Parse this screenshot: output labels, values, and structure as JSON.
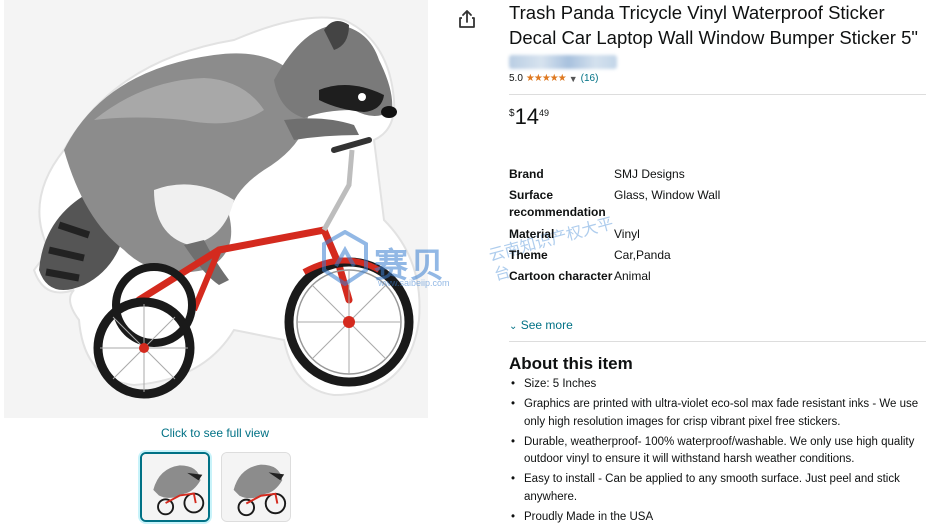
{
  "gallery": {
    "see_full_view": "Click to see full view",
    "thumbnails": [
      "raccoon-tricycle-sticker",
      "raccoon-tricycle-sticker"
    ]
  },
  "watermark": {
    "main": "赛贝",
    "side": "云南知识产权大平台",
    "url": "www.saibeiip.com"
  },
  "product": {
    "title": "Trash Panda Tricycle Vinyl Waterproof Sticker Decal Car Laptop Wall Window Bumper Sticker 5\"",
    "rating": "5.0",
    "stars": "★★★★★",
    "review_count": "(16)",
    "price_symbol": "$",
    "price_whole": "14",
    "price_fraction": "49",
    "specs": [
      {
        "key": "Brand",
        "value": "SMJ Designs"
      },
      {
        "key": "Surface recommendation",
        "value": "Glass, Window Wall"
      },
      {
        "key": "Material",
        "value": "Vinyl"
      },
      {
        "key": "Theme",
        "value": "Car,Panda"
      },
      {
        "key": "Cartoon character",
        "value": "Animal"
      }
    ],
    "see_more": "See more",
    "about_title": "About this item",
    "bullets": [
      "Size: 5 Inches",
      "Graphics are printed with ultra-violet eco-sol max fade resistant inks - We use only high resolution images for crisp vibrant pixel free stickers.",
      "Durable, weatherproof- 100% waterproof/washable. We only use high quality outdoor vinyl to ensure it will withstand harsh weather conditions.",
      "Easy to install - Can be applied to any smooth surface. Just peel and stick anywhere.",
      "Proudly Made in the USA"
    ]
  },
  "colors": {
    "link": "#007185",
    "star": "#de7921",
    "bike_red": "#d42a1e"
  }
}
